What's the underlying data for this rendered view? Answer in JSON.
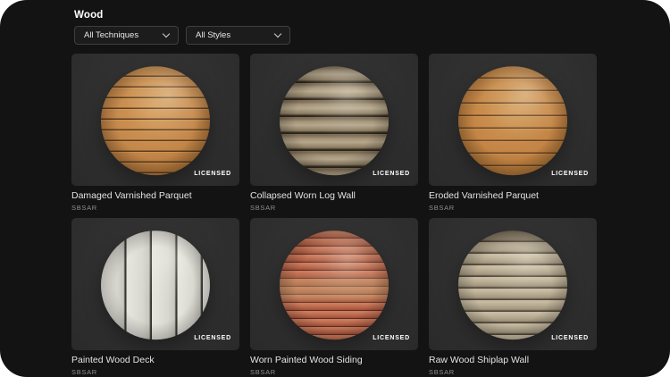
{
  "page": {
    "title": "Wood"
  },
  "filters": {
    "technique": {
      "value": "All Techniques"
    },
    "style": {
      "value": "All Styles"
    }
  },
  "cards": [
    {
      "title": "Damaged Varnished Parquet",
      "format": "SBSAR",
      "badge": "LICENSED",
      "variant": "tan-parquet-horizontal-planks"
    },
    {
      "title": "Collapsed Worn Log Wall",
      "format": "SBSAR",
      "badge": "LICENSED",
      "variant": "weathered-stacked-logs"
    },
    {
      "title": "Eroded Varnished Parquet",
      "format": "SBSAR",
      "badge": "LICENSED",
      "variant": "tan-parquet-horizontal-planks"
    },
    {
      "title": "Painted Wood Deck",
      "format": "SBSAR",
      "badge": "LICENSED",
      "variant": "white-painted-vertical-planks"
    },
    {
      "title": "Worn Painted Wood Siding",
      "format": "SBSAR",
      "badge": "LICENSED",
      "variant": "red-worn-horizontal-siding"
    },
    {
      "title": "Raw Wood Shiplap Wall",
      "format": "SBSAR",
      "badge": "LICENSED",
      "variant": "pale-raw-shiplap-boards"
    }
  ],
  "colors": {
    "frame_background": "#ffffff",
    "panel_background": "#131313",
    "tile_background": "#2f2f2f",
    "dropdown_border": "#3e3e3e",
    "title_text": "#e3e3e3",
    "format_text": "#8f8f8f"
  }
}
